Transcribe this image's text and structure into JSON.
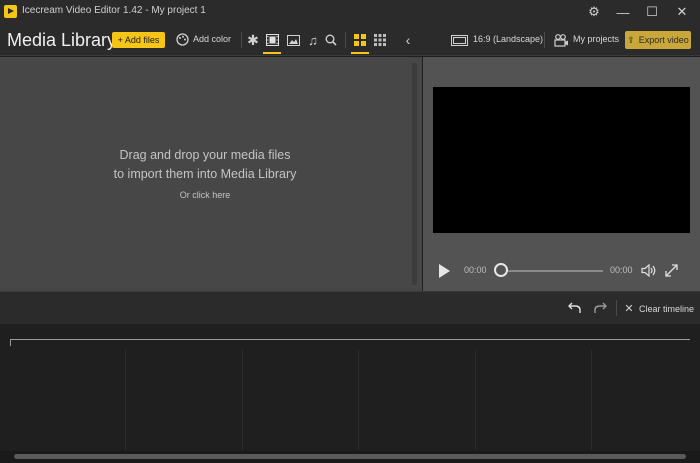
{
  "window": {
    "title": "Icecream Video Editor 1.42 - My project 1",
    "controls": {
      "settings_icon": "⚙",
      "minimize_icon": "—",
      "maximize_icon": "☐",
      "close_icon": "✕"
    }
  },
  "toolbar": {
    "section_title": "Media Library",
    "add_files_label": "+ Add files",
    "add_color_label": "Add color",
    "filter_icons": [
      "star-icon",
      "video-icon",
      "image-icon",
      "music-icon",
      "search-icon"
    ],
    "view_icons": [
      "grid-large-icon",
      "grid-small-icon"
    ],
    "collapse_icon": "chevron-left-icon",
    "aspect_ratio_label": "16:9 (Landscape)",
    "my_projects_label": "My projects",
    "export_label": "Export video"
  },
  "library": {
    "drop_line1": "Drag and drop your media files",
    "drop_line2": "to import them into Media Library",
    "click_here": "Or click here"
  },
  "player": {
    "current_time": "00:00",
    "total_time": "00:00",
    "progress": 0
  },
  "timeline_controls": {
    "clear_label": "Clear timeline"
  },
  "colors": {
    "accent": "#f5c518",
    "chrome": "#2b2b2b",
    "library_bg": "#474747",
    "preview_bg": "#535353",
    "timeline_bg": "#1f1f1f"
  }
}
